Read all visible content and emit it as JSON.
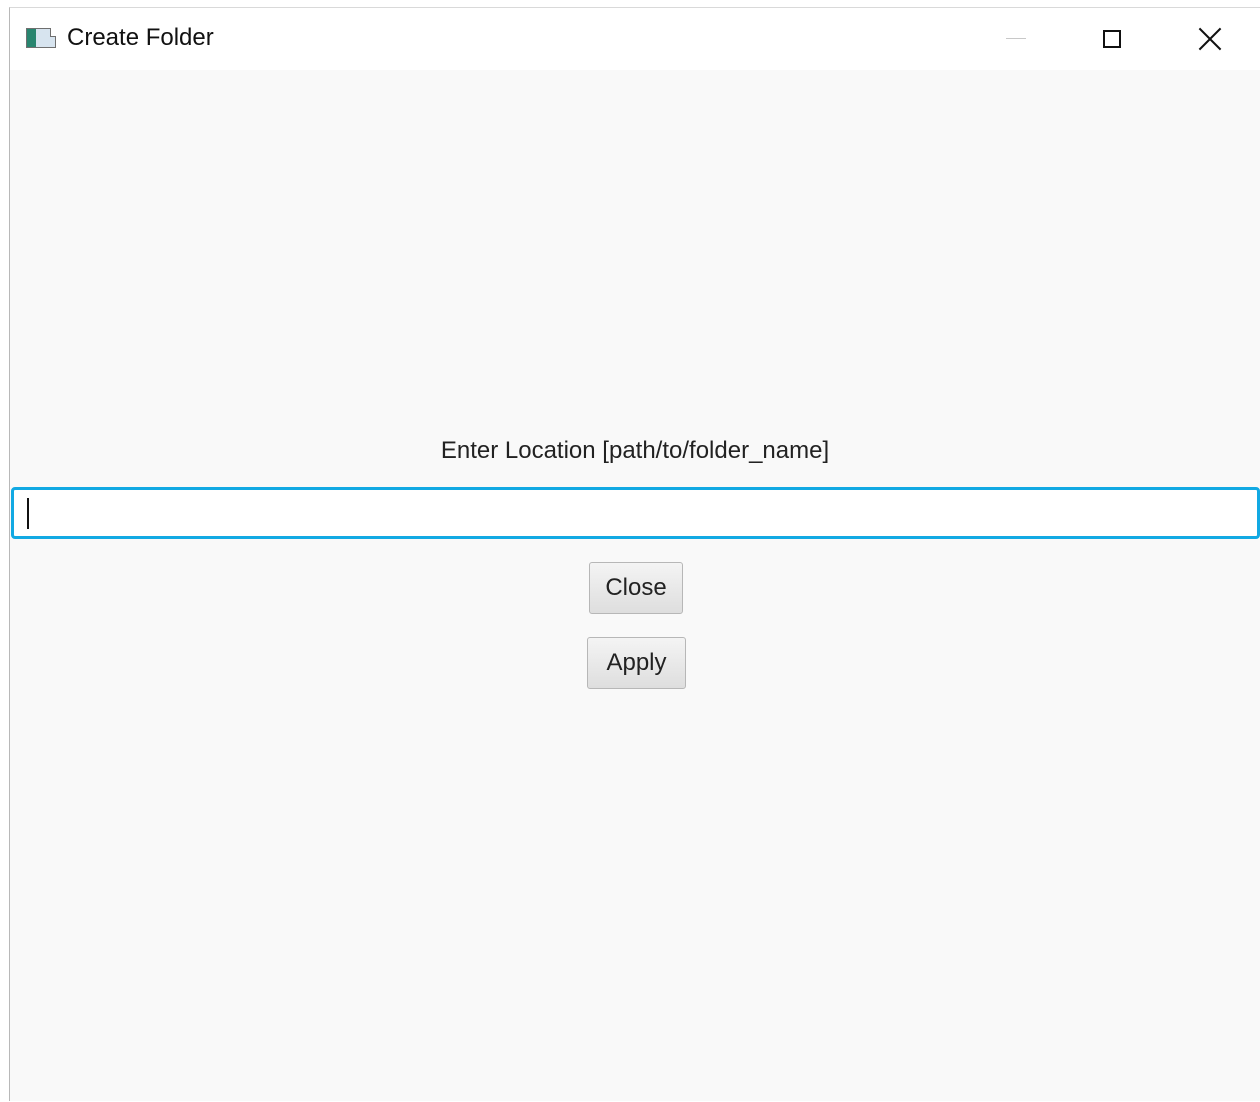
{
  "window": {
    "title": "Create Folder",
    "app_icon": "app-window-icon",
    "controls": {
      "minimize_icon": "minimize-icon",
      "maximize_icon": "maximize-icon",
      "close_icon": "close-icon"
    }
  },
  "form": {
    "prompt": "Enter Location [path/to/folder_name]",
    "path_value": "",
    "path_placeholder": ""
  },
  "buttons": {
    "close_label": "Close",
    "apply_label": "Apply"
  },
  "colors": {
    "focus_border": "#12a9e3",
    "window_background": "#f9f9f9"
  }
}
